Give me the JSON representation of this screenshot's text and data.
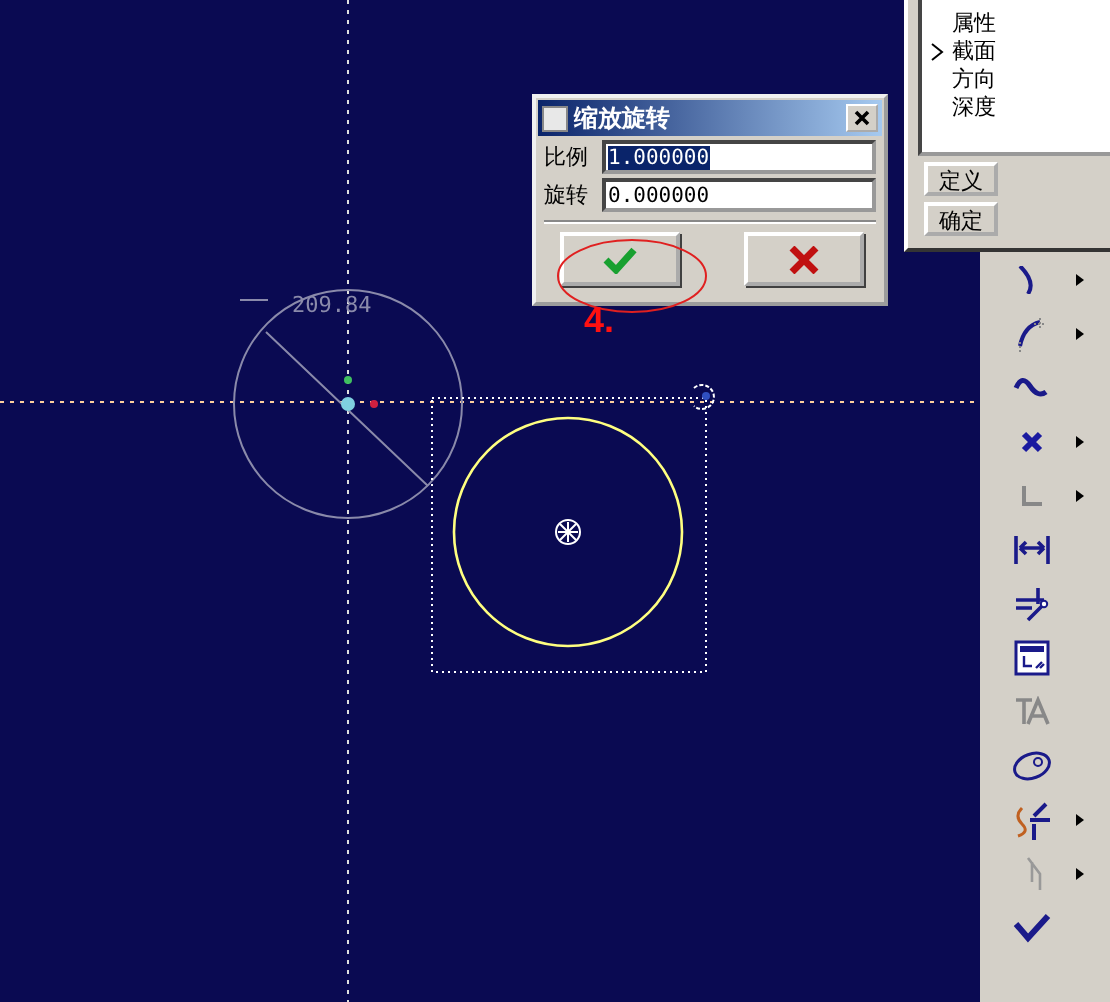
{
  "sketch": {
    "dimension": "209.84"
  },
  "dialog": {
    "title": "缩放旋转",
    "fields": [
      {
        "label": "比例",
        "value": "1.000000",
        "selected": true
      },
      {
        "label": "旋转",
        "value": "0.000000",
        "selected": false
      }
    ]
  },
  "annotation": {
    "label": "4."
  },
  "feature_panel": {
    "items": [
      {
        "label": "属性",
        "current": false
      },
      {
        "label": "截面",
        "current": true
      },
      {
        "label": "方向",
        "current": false
      },
      {
        "label": "深度",
        "current": false
      }
    ],
    "buttons": [
      "定义",
      "确定"
    ]
  },
  "toolbar": [
    {
      "has_menu": true
    },
    {
      "has_menu": true
    },
    {
      "has_menu": false
    },
    {
      "has_menu": true
    },
    {
      "has_menu": true
    },
    {
      "has_menu": false
    },
    {
      "has_menu": false
    },
    {
      "has_menu": false
    },
    {
      "has_menu": false
    },
    {
      "has_menu": false
    },
    {
      "has_menu": true
    },
    {
      "has_menu": true
    },
    {
      "has_menu": false
    }
  ]
}
